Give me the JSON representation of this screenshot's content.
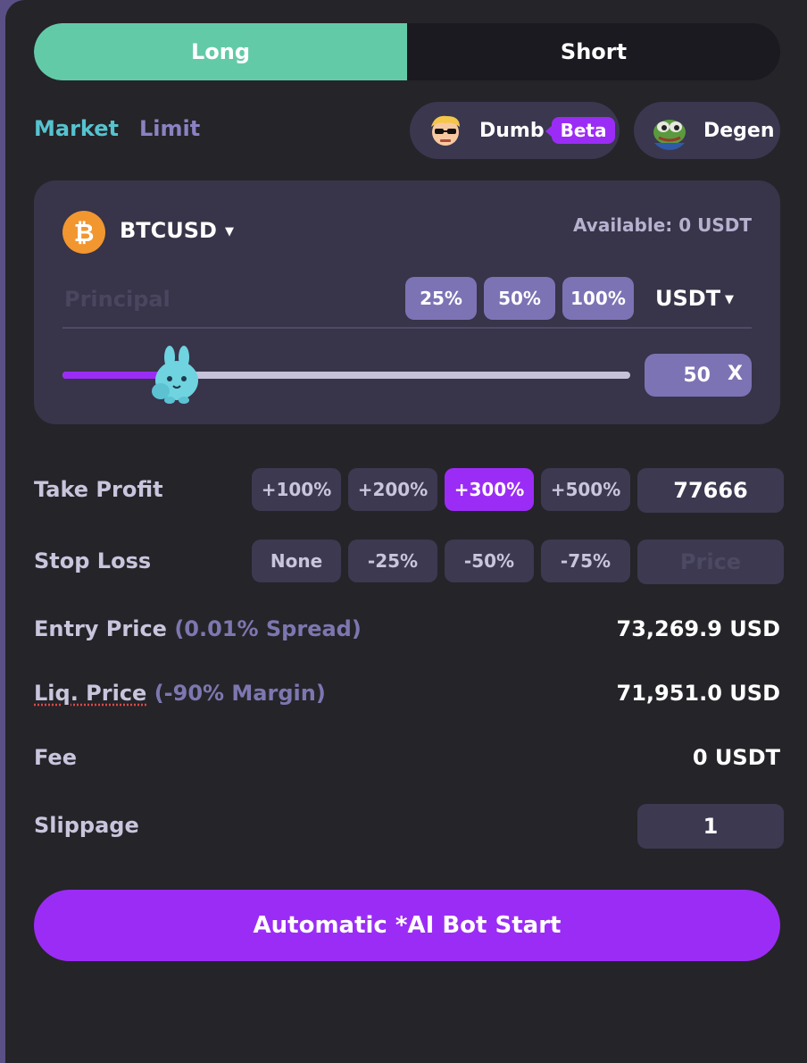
{
  "side_tabs": {
    "long": "Long",
    "short": "Short",
    "selected": "Long"
  },
  "order_types": {
    "market": "Market",
    "limit": "Limit",
    "selected": "Market"
  },
  "modes": {
    "dumb": {
      "label": "Dumb",
      "badge": "Beta",
      "icon": "trader-avatar-icon"
    },
    "degen": {
      "label": "Degen",
      "icon": "pepe-frog-icon"
    }
  },
  "trade": {
    "pair": "BTCUSD",
    "coin_icon": "bitcoin-icon",
    "coin_symbol": "₿",
    "available": "Available: 0 USDT",
    "principal_placeholder": "Principal",
    "principal_value": "",
    "pct_buttons": [
      "25%",
      "50%",
      "100%"
    ],
    "currency": "USDT",
    "leverage_value": "50",
    "leverage_suffix": "X",
    "slider_level": 0.2
  },
  "take_profit": {
    "label": "Take Profit",
    "options": [
      "+100%",
      "+200%",
      "+300%",
      "+500%"
    ],
    "selected": "+300%",
    "value": "77666"
  },
  "stop_loss": {
    "label": "Stop Loss",
    "options": [
      "None",
      "-25%",
      "-50%",
      "-75%"
    ],
    "placeholder": "Price"
  },
  "entry": {
    "label": "Entry Price",
    "sub": "(0.01% Spread)",
    "value": "73,269.9 USD"
  },
  "liq": {
    "label": "Liq. Price",
    "sub": "(-90% Margin)",
    "value": "71,951.0 USD"
  },
  "fee": {
    "label": "Fee",
    "value": "0 USDT"
  },
  "slippage": {
    "label": "Slippage",
    "value": "1"
  },
  "cta": "Automatic *AI Bot Start",
  "colors": {
    "long_green": "#63caa8",
    "accent_purple": "#9b2cf5",
    "market_teal": "#56c3cf",
    "bitcoin_orange": "#f2962f"
  }
}
